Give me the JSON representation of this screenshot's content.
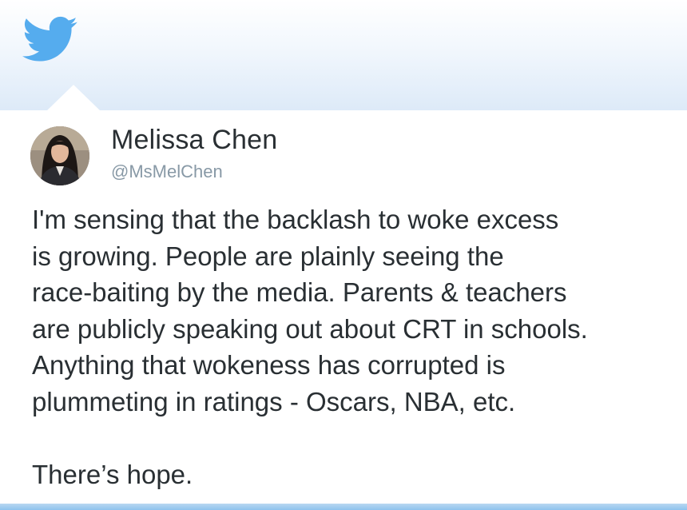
{
  "header": {
    "logo_icon": "twitter-bird-icon",
    "accent_color": "#55acee"
  },
  "tweet": {
    "author": {
      "name": "Melissa Chen",
      "handle": "@MsMelChen",
      "avatar_icon": "profile-photo"
    },
    "text_lines": [
      "I'm sensing that the backlash to woke excess",
      "is growing. People are plainly seeing the",
      "race-baiting by the media. Parents & teachers",
      "are publicly speaking out about CRT in schools.",
      "Anything that wokeness has corrupted is",
      "plummeting in ratings - Oscars, NBA, etc."
    ],
    "closing_line": "There’s hope."
  }
}
